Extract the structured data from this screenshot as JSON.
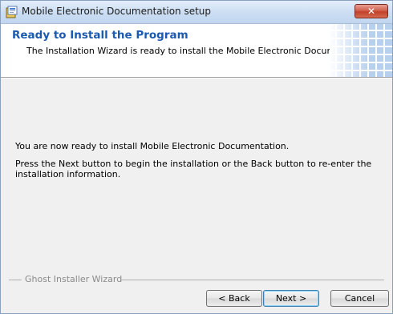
{
  "window": {
    "title": "Mobile Electronic Documentation setup",
    "close_label": "✕"
  },
  "header": {
    "title": "Ready to Install the Program",
    "subtitle": "The Installation Wizard is ready to install the Mobile Electronic Documentation."
  },
  "content": {
    "line1": "You are now ready to install Mobile Electronic Documentation.",
    "line2": "Press the Next button to begin the installation or the Back button to re-enter the installation information."
  },
  "footer": {
    "group_label": "Ghost Installer Wizard"
  },
  "buttons": {
    "back": "< Back",
    "next": "Next >",
    "cancel": "Cancel"
  },
  "colors": {
    "title_blue": "#1b5ab0",
    "close_red": "#c2412a"
  }
}
